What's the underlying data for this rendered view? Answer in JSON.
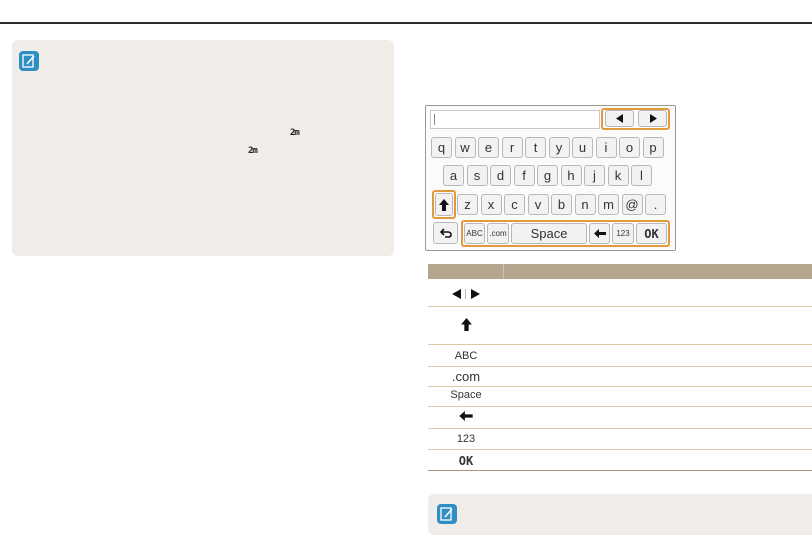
{
  "keyboard": {
    "row1": [
      "q",
      "w",
      "e",
      "r",
      "t",
      "y",
      "u",
      "i",
      "o",
      "p"
    ],
    "row2": [
      "a",
      "s",
      "d",
      "f",
      "g",
      "h",
      "j",
      "k",
      "l"
    ],
    "row3": [
      "z",
      "x",
      "c",
      "v",
      "b",
      "n",
      "m",
      "@",
      "."
    ],
    "abc_label": "ABC",
    "dotcom_label": ".com",
    "space_label": "Space",
    "num_label": "123",
    "ok_label": "OK"
  },
  "table": {
    "rows": [
      {
        "icon": "arrow-left-right-icon"
      },
      {
        "icon": "shift-up-icon"
      },
      {
        "label": "ABC"
      },
      {
        "label": ".com"
      },
      {
        "label": "Space"
      },
      {
        "icon": "backspace-left-icon"
      },
      {
        "label": "123"
      },
      {
        "label": "OK"
      }
    ]
  },
  "colors": {
    "highlight": "#e39a3d",
    "note_bg": "#f0ede8",
    "table_head": "#b5a68f",
    "note_icon": "#2f8fc4"
  }
}
